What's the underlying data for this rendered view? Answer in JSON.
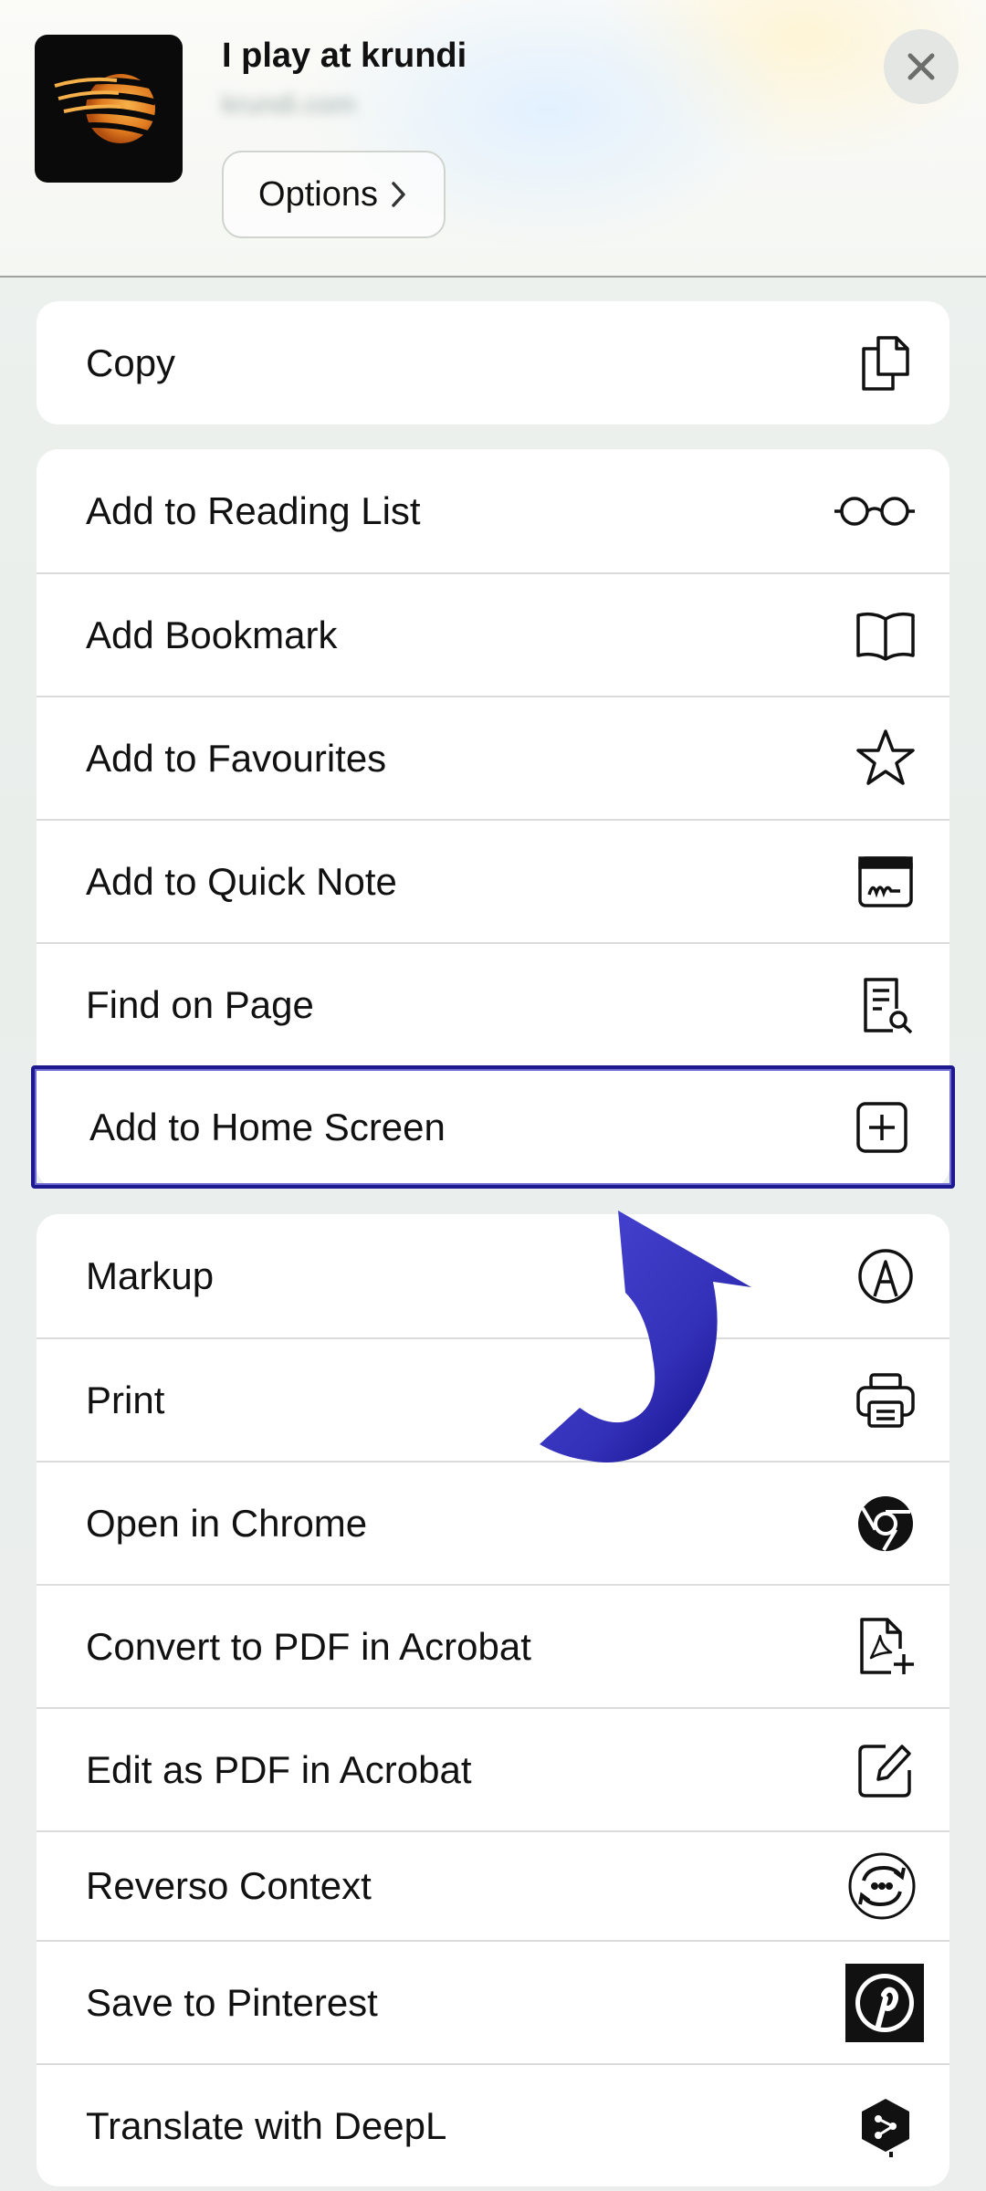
{
  "header": {
    "title": "I play at krundi",
    "url": "krundi.com",
    "options_label": "Options",
    "app_icon": "krundi-logo",
    "close_icon": "close-icon"
  },
  "groups": [
    {
      "items": [
        {
          "label": "Copy",
          "icon": "copy-icon"
        }
      ]
    },
    {
      "items": [
        {
          "label": "Add to Reading List",
          "icon": "glasses-icon"
        },
        {
          "label": "Add Bookmark",
          "icon": "book-icon"
        },
        {
          "label": "Add to Favourites",
          "icon": "star-icon"
        },
        {
          "label": "Add to Quick Note",
          "icon": "quick-note-icon"
        },
        {
          "label": "Find on Page",
          "icon": "find-document-icon"
        },
        {
          "label": "Add to Home Screen",
          "icon": "plus-square-icon"
        }
      ]
    },
    {
      "items": [
        {
          "label": "Markup",
          "icon": "markup-pen-icon"
        },
        {
          "label": "Print",
          "icon": "printer-icon"
        },
        {
          "label": "Open in Chrome",
          "icon": "chrome-icon"
        },
        {
          "label": "Convert to PDF in Acrobat",
          "icon": "pdf-plus-icon"
        },
        {
          "label": "Edit as PDF in Acrobat",
          "icon": "edit-square-icon"
        },
        {
          "label": "Reverso Context",
          "icon": "reverso-icon"
        },
        {
          "label": "Save to Pinterest",
          "icon": "pinterest-icon"
        },
        {
          "label": "Translate with DeepL",
          "icon": "deepl-icon"
        }
      ]
    }
  ],
  "highlight_color": "#1d1a8f",
  "arrow_color": "#2d2ab0"
}
